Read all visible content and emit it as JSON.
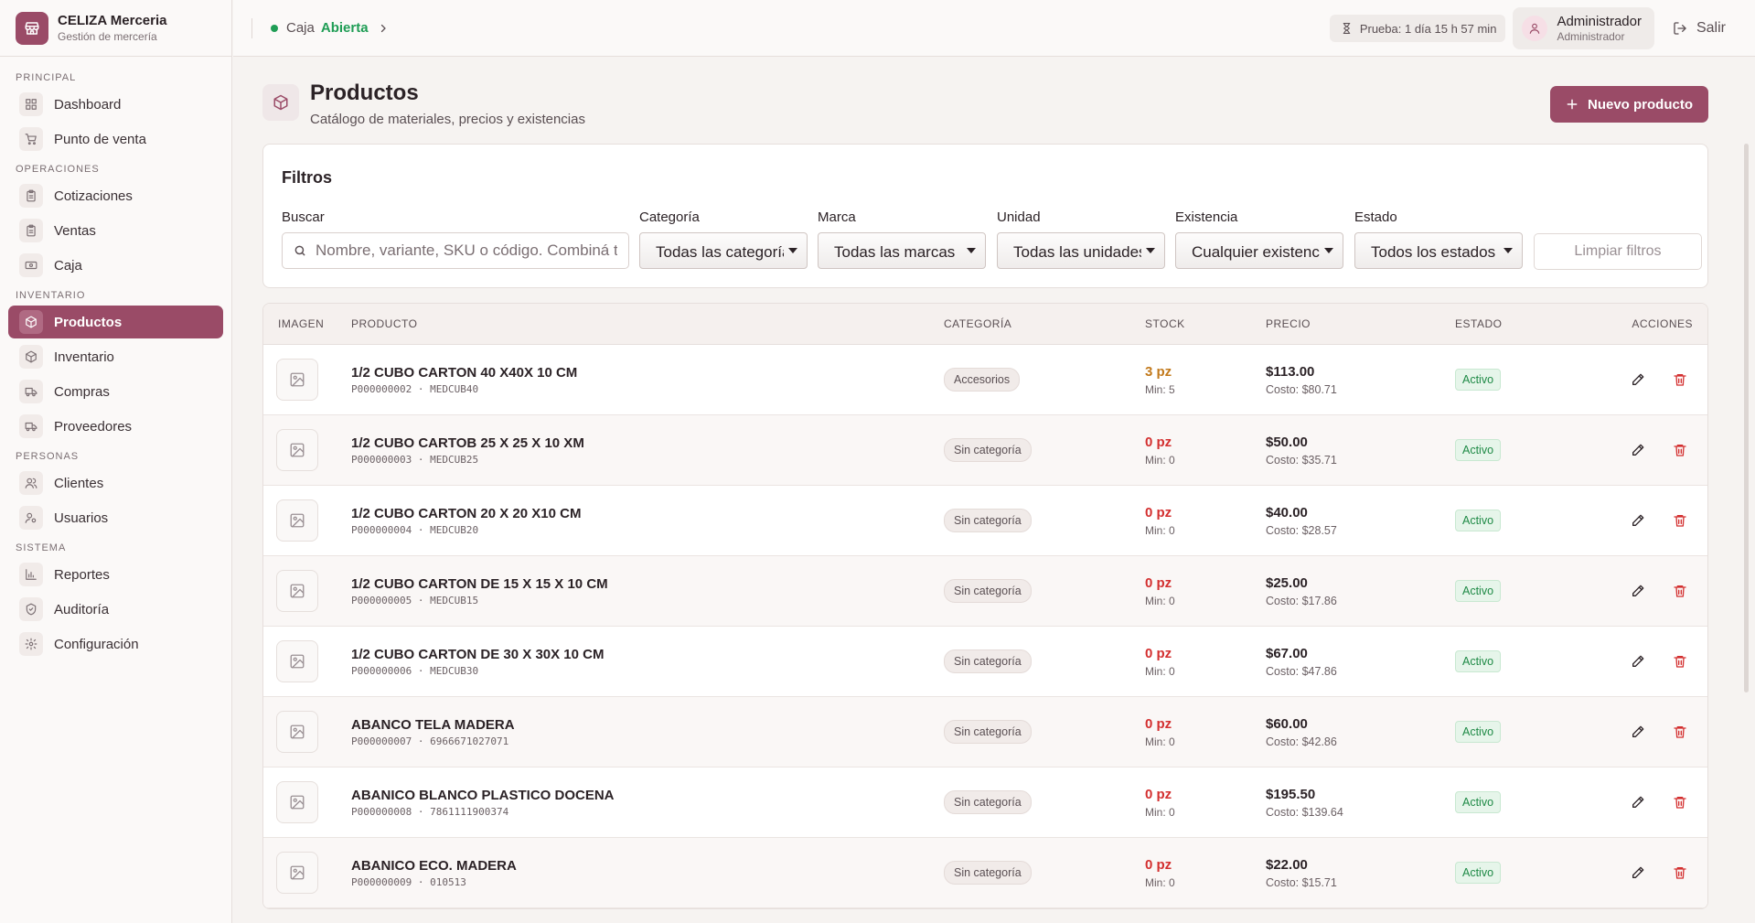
{
  "brand": {
    "name": "CELIZA Merceria",
    "subtitle": "Gestión de mercería"
  },
  "sidebar": {
    "sections": [
      {
        "title": "PRINCIPAL",
        "items": [
          "Dashboard",
          "Punto de venta"
        ]
      },
      {
        "title": "OPERACIONES",
        "items": [
          "Cotizaciones",
          "Ventas",
          "Caja"
        ]
      },
      {
        "title": "INVENTARIO",
        "items": [
          "Productos",
          "Inventario",
          "Compras",
          "Proveedores"
        ]
      },
      {
        "title": "PERSONAS",
        "items": [
          "Clientes",
          "Usuarios"
        ]
      },
      {
        "title": "SISTEMA",
        "items": [
          "Reportes",
          "Auditoría",
          "Configuración"
        ]
      }
    ],
    "active": "Productos"
  },
  "topbar": {
    "caja_label": "Caja",
    "caja_status": "Abierta",
    "trial": "Prueba: 1 día 15 h 57 min",
    "user_name": "Administrador",
    "user_role": "Administrador",
    "logout": "Salir"
  },
  "page": {
    "title": "Productos",
    "subtitle": "Catálogo de materiales, precios y existencias",
    "new_button": "Nuevo producto"
  },
  "filters": {
    "title": "Filtros",
    "search_label": "Buscar",
    "search_placeholder": "Nombre, variante, SKU o código. Combiná términos",
    "categoria_label": "Categoría",
    "categoria_value": "Todas las categorías",
    "marca_label": "Marca",
    "marca_value": "Todas las marcas",
    "unidad_label": "Unidad",
    "unidad_value": "Todas las unidades",
    "existencia_label": "Existencia",
    "existencia_value": "Cualquier existencia",
    "estado_label": "Estado",
    "estado_value": "Todos los estados",
    "clear_button": "Limpiar filtros"
  },
  "table": {
    "headers": [
      "IMAGEN",
      "PRODUCTO",
      "CATEGORÍA",
      "STOCK",
      "PRECIO",
      "ESTADO",
      "ACCIONES"
    ],
    "rows": [
      {
        "name": "1/2 CUBO CARTON 40 X40X 10 CM",
        "code": "P000000002 · MEDCUB40",
        "category": "Accesorios",
        "stock": "3 pz",
        "stock_color": "#c2791b",
        "min": "Min: 5",
        "price": "$113.00",
        "cost": "Costo: $80.71",
        "state": "Activo"
      },
      {
        "name": "1/2 CUBO CARTOB 25 X 25 X 10 XM",
        "code": "P000000003 · MEDCUB25",
        "category": "Sin categoría",
        "stock": "0 pz",
        "stock_color": "#d32f2f",
        "min": "Min: 0",
        "price": "$50.00",
        "cost": "Costo: $35.71",
        "state": "Activo"
      },
      {
        "name": "1/2 CUBO CARTON 20 X 20 X10 CM",
        "code": "P000000004 · MEDCUB20",
        "category": "Sin categoría",
        "stock": "0 pz",
        "stock_color": "#d32f2f",
        "min": "Min: 0",
        "price": "$40.00",
        "cost": "Costo: $28.57",
        "state": "Activo"
      },
      {
        "name": "1/2 CUBO CARTON DE 15 X 15 X 10 CM",
        "code": "P000000005 · MEDCUB15",
        "category": "Sin categoría",
        "stock": "0 pz",
        "stock_color": "#d32f2f",
        "min": "Min: 0",
        "price": "$25.00",
        "cost": "Costo: $17.86",
        "state": "Activo"
      },
      {
        "name": "1/2 CUBO CARTON DE 30 X 30X 10 CM",
        "code": "P000000006 · MEDCUB30",
        "category": "Sin categoría",
        "stock": "0 pz",
        "stock_color": "#d32f2f",
        "min": "Min: 0",
        "price": "$67.00",
        "cost": "Costo: $47.86",
        "state": "Activo"
      },
      {
        "name": "ABANCO TELA MADERA",
        "code": "P000000007 · 6966671027071",
        "category": "Sin categoría",
        "stock": "0 pz",
        "stock_color": "#d32f2f",
        "min": "Min: 0",
        "price": "$60.00",
        "cost": "Costo: $42.86",
        "state": "Activo"
      },
      {
        "name": "ABANICO BLANCO PLASTICO DOCENA",
        "code": "P000000008 · 7861111900374",
        "category": "Sin categoría",
        "stock": "0 pz",
        "stock_color": "#d32f2f",
        "min": "Min: 0",
        "price": "$195.50",
        "cost": "Costo: $139.64",
        "state": "Activo"
      },
      {
        "name": "ABANICO ECO. MADERA",
        "code": "P000000009 · 010513",
        "category": "Sin categoría",
        "stock": "0 pz",
        "stock_color": "#d32f2f",
        "min": "Min: 0",
        "price": "$22.00",
        "cost": "Costo: $15.71",
        "state": "Activo"
      }
    ]
  },
  "colors": {
    "accent": "#9a4b67",
    "success": "#1f9d55",
    "danger": "#d32f2f",
    "warning": "#c2791b"
  }
}
